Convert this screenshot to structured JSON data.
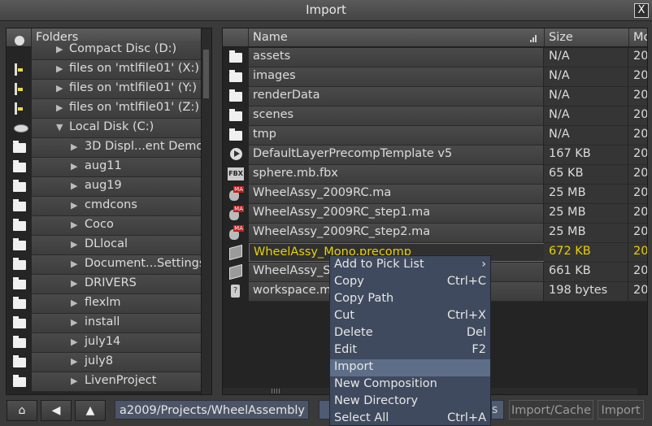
{
  "window": {
    "title": "Import",
    "close_label": "X"
  },
  "folders": {
    "header": "Folders",
    "items": [
      {
        "label": "Compact Disc (D:)",
        "icon": "cd-icon",
        "indent": 0
      },
      {
        "label": "files on 'mtlfile01' (X:)",
        "icon": "network-drive-icon",
        "indent": 0
      },
      {
        "label": "files on 'mtlfile01' (Y:)",
        "icon": "network-drive-icon",
        "indent": 0
      },
      {
        "label": "files on 'mtlfile01' (Z:)",
        "icon": "network-drive-icon",
        "indent": 0
      },
      {
        "label": "Local Disk (C:)",
        "icon": "hard-disk-icon",
        "indent": 0,
        "expanded": true
      },
      {
        "label": "3D Displ...ent Demo",
        "icon": "folder-icon",
        "indent": 1
      },
      {
        "label": "aug11",
        "icon": "folder-icon",
        "indent": 1
      },
      {
        "label": "aug19",
        "icon": "folder-icon",
        "indent": 1
      },
      {
        "label": "cmdcons",
        "icon": "folder-icon",
        "indent": 1
      },
      {
        "label": "Coco",
        "icon": "folder-icon",
        "indent": 1
      },
      {
        "label": "DLlocal",
        "icon": "folder-icon",
        "indent": 1
      },
      {
        "label": "Document...Settings",
        "icon": "folder-icon",
        "indent": 1
      },
      {
        "label": "DRIVERS",
        "icon": "folder-icon",
        "indent": 1
      },
      {
        "label": "flexlm",
        "icon": "folder-icon",
        "indent": 1
      },
      {
        "label": "install",
        "icon": "folder-icon",
        "indent": 1
      },
      {
        "label": "july14",
        "icon": "folder-icon",
        "indent": 1
      },
      {
        "label": "july8",
        "icon": "folder-icon",
        "indent": 1
      },
      {
        "label": "LivenProject",
        "icon": "folder-icon",
        "indent": 1
      }
    ]
  },
  "files": {
    "columns": {
      "name": "Name",
      "size": "Size",
      "modified": "Mo"
    },
    "rows": [
      {
        "name": "assets",
        "size": "N/A",
        "modified": "20",
        "icon": "folder-icon"
      },
      {
        "name": "images",
        "size": "N/A",
        "modified": "20",
        "icon": "folder-icon"
      },
      {
        "name": "renderData",
        "size": "N/A",
        "modified": "20",
        "icon": "folder-icon"
      },
      {
        "name": "scenes",
        "size": "N/A",
        "modified": "20",
        "icon": "folder-icon"
      },
      {
        "name": "tmp",
        "size": "N/A",
        "modified": "20",
        "icon": "folder-icon"
      },
      {
        "name": "DefaultLayerPrecompTemplate v5",
        "size": "167 KB",
        "modified": "20",
        "icon": "precomp-template-icon"
      },
      {
        "name": "sphere.mb.fbx",
        "size": "65 KB",
        "modified": "20",
        "icon": "fbx-file-icon"
      },
      {
        "name": "WheelAssy_2009RC.ma",
        "size": "25 MB",
        "modified": "20",
        "icon": "maya-file-icon"
      },
      {
        "name": "WheelAssy_2009RC_step1.ma",
        "size": "25 MB",
        "modified": "20",
        "icon": "maya-file-icon"
      },
      {
        "name": "WheelAssy_2009RC_step2.ma",
        "size": "25 MB",
        "modified": "20",
        "icon": "maya-file-icon"
      },
      {
        "name": "WheelAssy_Mono.precomp",
        "size": "672 KB",
        "modified": "20",
        "icon": "precomp-icon",
        "selected": true
      },
      {
        "name": "WheelAssy_S",
        "size": "661 KB",
        "modified": "20",
        "icon": "precomp-icon"
      },
      {
        "name": "workspace.m",
        "size": "198 bytes",
        "modified": "20",
        "icon": "workspace-file-icon"
      }
    ]
  },
  "context_menu": {
    "items": [
      {
        "label": "Add to Pick List",
        "shortcut": "›"
      },
      {
        "label": "Copy",
        "shortcut": "Ctrl+C"
      },
      {
        "label": "Copy Path",
        "shortcut": ""
      },
      {
        "label": "Cut",
        "shortcut": "Ctrl+X"
      },
      {
        "label": "Delete",
        "shortcut": "Del"
      },
      {
        "label": "Edit",
        "shortcut": "F2"
      },
      {
        "label": "Import",
        "shortcut": "",
        "highlighted": true
      },
      {
        "label": "New Composition",
        "shortcut": ""
      },
      {
        "label": "New Directory",
        "shortcut": ""
      },
      {
        "label": "Select All",
        "shortcut": "Ctrl+A"
      }
    ]
  },
  "bottom": {
    "home_icon": "home-icon",
    "back_icon": "back-arrow-icon",
    "up_icon": "up-arrow-icon",
    "path": "a2009/Projects/WheelAssembly",
    "partial_button_tail": "s",
    "import_cache_label": "Import/Cache",
    "import_label": "Import"
  },
  "colors": {
    "accent_selection": "#e8d000",
    "menu_bg": "#3f4a5e",
    "menu_highlight": "#5e6e88",
    "path_bg": "#4c5566"
  }
}
